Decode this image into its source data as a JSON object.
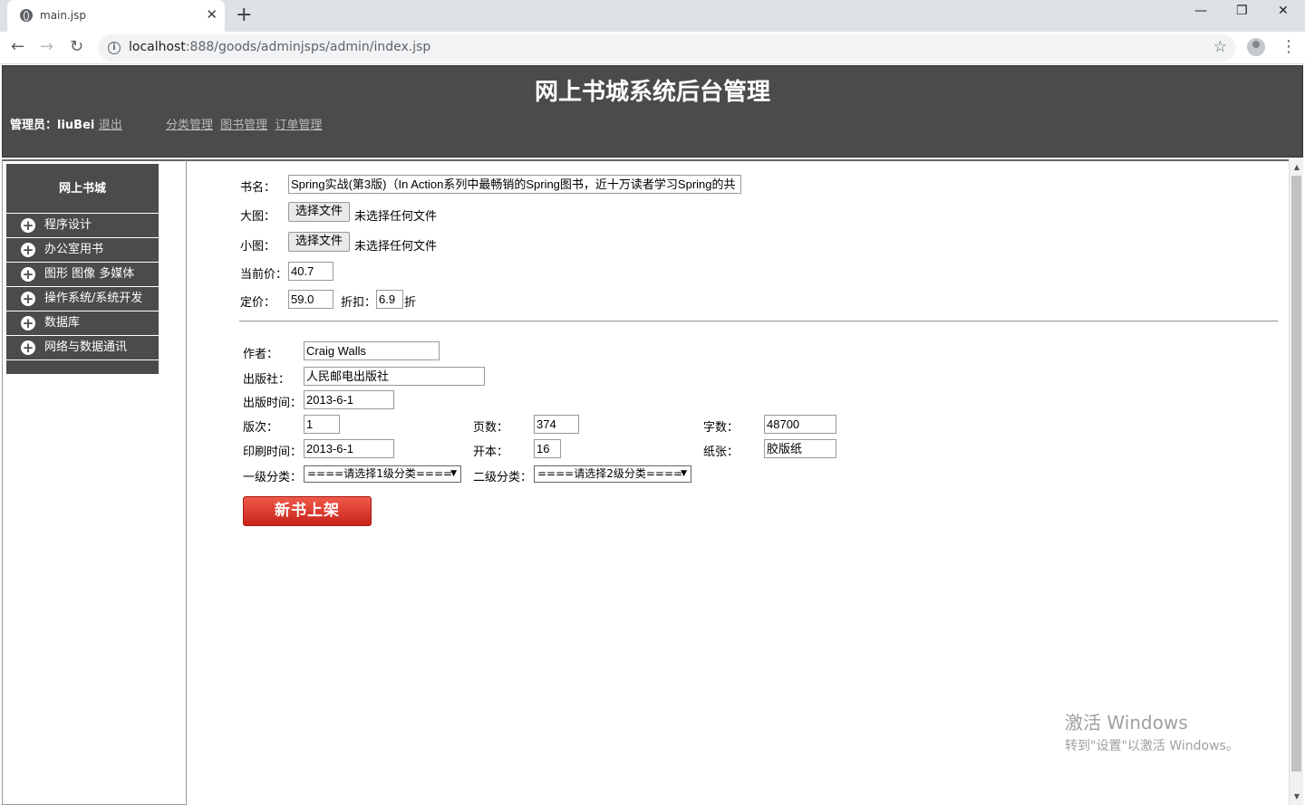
{
  "browser": {
    "tab_title": "main.jsp",
    "tab_close": "✕",
    "new_tab": "+",
    "minimize": "—",
    "maximize": "❐",
    "close": "✕",
    "url_host": "localhost",
    "url_rest": ":888/goods/adminjsps/admin/index.jsp"
  },
  "header": {
    "title": "网上书城系统后台管理",
    "admin_label": "管理员：liuBei",
    "logout": "退出",
    "nav": [
      "分类管理",
      "图书管理",
      "订单管理"
    ]
  },
  "sidebar": {
    "title": "网上书城",
    "items": [
      "程序设计",
      "办公室用书",
      "图形 图像 多媒体",
      "操作系统/系统开发",
      "数据库",
      "网络与数据通讯"
    ]
  },
  "form": {
    "name_label": "书名：",
    "name_value": "Spring实战(第3版)（In Action系列中最畅销的Spring图书，近十万读者学习Spring的共",
    "big_image_label": "大图：",
    "small_image_label": "小图：",
    "choose_file": "选择文件",
    "no_file": "未选择任何文件",
    "current_price_label": "当前价：",
    "current_price": "40.7",
    "price_label": "定价：",
    "price": "59.0",
    "discount_label": "折扣：",
    "discount": "6.9",
    "discount_unit": "折",
    "author_label": "作者：",
    "author": "Craig Walls",
    "press_label": "出版社：",
    "press": "人民邮电出版社",
    "publish_time_label": "出版时间：",
    "publish_time": "2013-6-1",
    "edition_label": "版次：",
    "edition": "1",
    "pages_label": "页数：",
    "pages": "374",
    "words_label": "字数：",
    "words": "48700",
    "print_time_label": "印刷时间：",
    "print_time": "2013-6-1",
    "booksize_label": "开本：",
    "booksize": "16",
    "paper_label": "纸张：",
    "paper": "胶版纸",
    "cat1_label": "一级分类：",
    "cat1": "====请选择1级分类====",
    "cat2_label": "二级分类：",
    "cat2": "====请选择2级分类====",
    "submit": "新书上架"
  },
  "watermark": {
    "line1": "激活 Windows",
    "line2": "转到\"设置\"以激活 Windows。"
  }
}
